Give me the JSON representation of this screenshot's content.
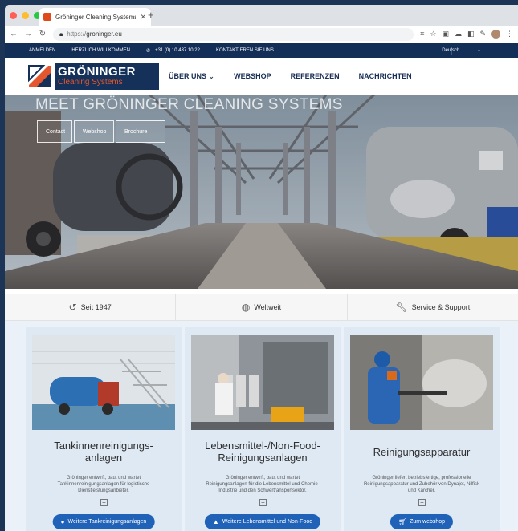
{
  "browser": {
    "tab_title": "Gröninger Cleaning Systems",
    "new_tab": "+",
    "url_scheme": "https://",
    "url_host": "groninger.eu",
    "lock": "lock-icon"
  },
  "topbar": {
    "login": "ANMELDEN",
    "welcome": "HERZLICH WILLKOMMEN",
    "phone": "+31 (0) 10 437 10 22",
    "contact": "KONTAKTIEREN SIE UNS",
    "language": "Deutsch"
  },
  "logo": {
    "name": "GRÖNINGER",
    "tagline": "Cleaning Systems"
  },
  "nav": {
    "items": [
      "ÜBER UNS",
      "WEBSHOP",
      "REFERENZEN",
      "NACHRICHTEN"
    ]
  },
  "hero": {
    "title": "MEET GRÖNINGER CLEANING SYSTEMS",
    "buttons": [
      "Contact",
      "Webshop",
      "Brochure"
    ]
  },
  "features": [
    {
      "icon": "history-icon",
      "label": "Seit 1947"
    },
    {
      "icon": "globe-icon",
      "label": "Weltweit"
    },
    {
      "icon": "wrench-icon",
      "label": "Service & Support"
    }
  ],
  "cards": [
    {
      "title_line1": "Tankinnenreinigungs-",
      "title_line2": "anlagen",
      "text_line1": "Gröninger entwirft, baut und wartet",
      "text_line2": "Tankinnenreinigungsanlagen für logistische",
      "text_line3": "Dienstleistungsanbieter.",
      "button": "Weitere Tankreinigungsanlagen"
    },
    {
      "title_line1": "Lebensmittel-/Non-Food-",
      "title_line2": "Reinigungsanlagen",
      "text_line1": "Gröninger entwirft, baut und wartet",
      "text_line2": "Reinigungsanlagen für die Lebensmittel und Chemie-",
      "text_line3": "Industrie und den Schwertransportsektor.",
      "button": "Weitere Lebensmittel und Non-Food"
    },
    {
      "title_line1": "Reinigungsapparatur",
      "title_line2": "",
      "text_line1": "Gröninger liefert betriebsfertige, professionelle",
      "text_line2": "Reinigungsapparatur und Zubehör von Dynajet, Nilfisk",
      "text_line3": "und Kärcher.",
      "button": "Zum webshop"
    }
  ],
  "colors": {
    "brand_navy": "#142f57",
    "brand_orange": "#e4572e",
    "button_blue": "#1f62b8"
  }
}
